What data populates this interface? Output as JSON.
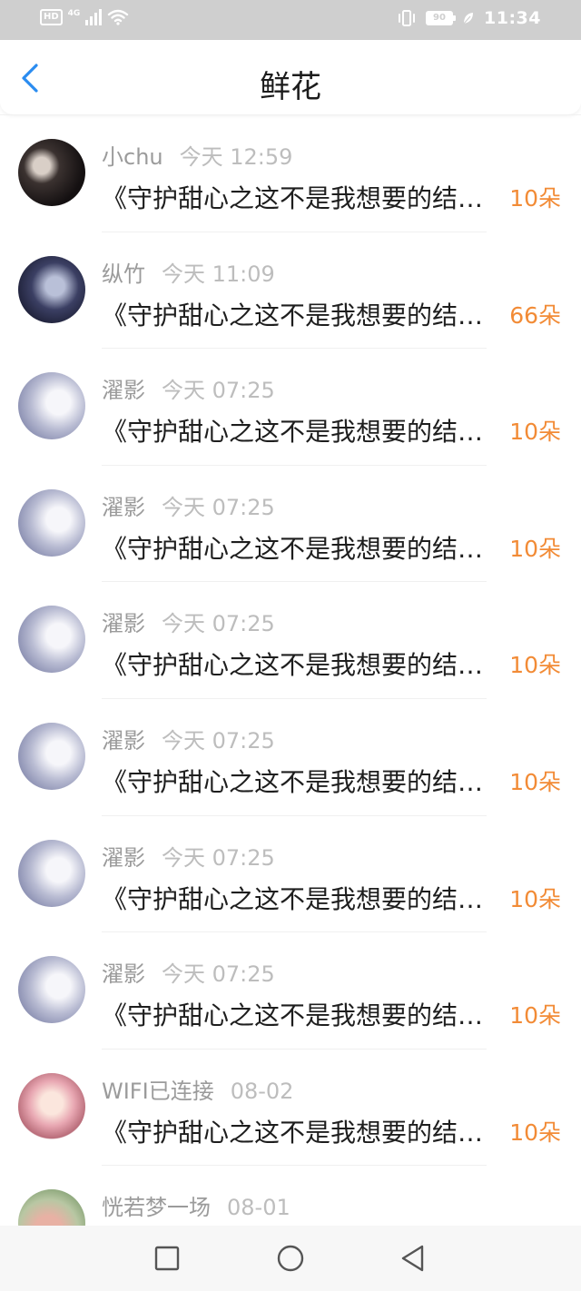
{
  "status_bar": {
    "hd": "HD",
    "network": "4G",
    "battery": "90",
    "time": "11:34"
  },
  "header": {
    "title": "鲜花",
    "back_icon": "chevron-left-icon"
  },
  "colors": {
    "accent_blue": "#2a8cf0",
    "count_orange": "#f28b36"
  },
  "list": [
    {
      "name": "小chu",
      "time": "今天 12:59",
      "message": "《守护甜心之这不是我想要的结局》",
      "count": "10朵",
      "avatar": "dark"
    },
    {
      "name": "纵竹",
      "time": "今天 11:09",
      "message": "《守护甜心之这不是我想要的结局》",
      "count": "66朵",
      "avatar": "anime-blue"
    },
    {
      "name": "濯影",
      "time": "今天 07:25",
      "message": "《守护甜心之这不是我想要的结局》",
      "count": "10朵",
      "avatar": "pale"
    },
    {
      "name": "濯影",
      "time": "今天 07:25",
      "message": "《守护甜心之这不是我想要的结局》",
      "count": "10朵",
      "avatar": "pale"
    },
    {
      "name": "濯影",
      "time": "今天 07:25",
      "message": "《守护甜心之这不是我想要的结局》",
      "count": "10朵",
      "avatar": "pale"
    },
    {
      "name": "濯影",
      "time": "今天 07:25",
      "message": "《守护甜心之这不是我想要的结局》",
      "count": "10朵",
      "avatar": "pale"
    },
    {
      "name": "濯影",
      "time": "今天 07:25",
      "message": "《守护甜心之这不是我想要的结局》",
      "count": "10朵",
      "avatar": "pale"
    },
    {
      "name": "濯影",
      "time": "今天 07:25",
      "message": "《守护甜心之这不是我想要的结局》",
      "count": "10朵",
      "avatar": "pale"
    },
    {
      "name": "WIFI已连接",
      "time": "08-02",
      "message": "《守护甜心之这不是我想要的结局》",
      "count": "10朵",
      "avatar": "pink"
    },
    {
      "name": "恍若梦一场",
      "time": "08-01",
      "message": "",
      "count": "",
      "avatar": "flower"
    }
  ],
  "nav_bar": {
    "recent_icon": "square-icon",
    "home_icon": "circle-icon",
    "back_icon": "triangle-back-icon"
  }
}
